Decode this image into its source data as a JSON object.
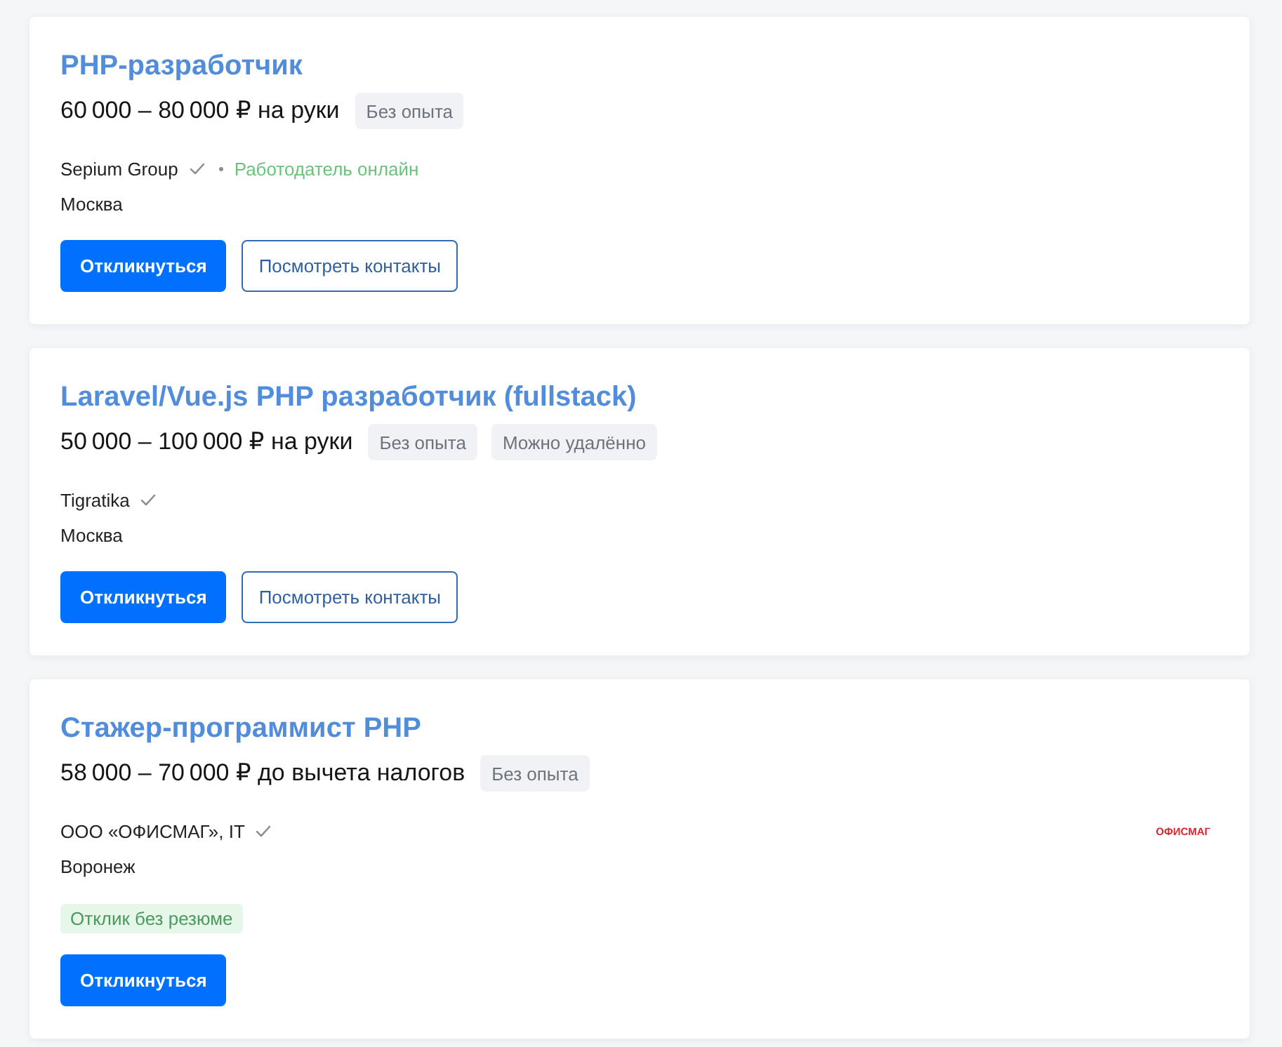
{
  "vacancies": [
    {
      "title": "PHP-разработчик",
      "salary": "60 000 – 80 000 ₽ на руки",
      "tags": [
        "Без опыта"
      ],
      "company": "Sepium Group",
      "verified": true,
      "online_status": "Работодатель онлайн",
      "city": "Москва",
      "buttons": [
        {
          "label": "Откликнуться",
          "kind": "primary"
        },
        {
          "label": "Посмотреть контакты",
          "kind": "outline"
        }
      ]
    },
    {
      "title": "Laravel/Vue.js PHP разработчик (fullstack)",
      "salary": "50 000 – 100 000 ₽ на руки",
      "tags": [
        "Без опыта",
        "Можно удалённо"
      ],
      "company": "Tigratika",
      "verified": true,
      "city": "Москва",
      "buttons": [
        {
          "label": "Откликнуться",
          "kind": "primary"
        },
        {
          "label": "Посмотреть контакты",
          "kind": "outline"
        }
      ]
    },
    {
      "title": "Стажер-программист PHP",
      "salary": "58 000 – 70 000 ₽ до вычета налогов",
      "tags": [
        "Без опыта"
      ],
      "company": "ООО «ОФИСМАГ», IT",
      "verified": true,
      "logo": "ОФИСМАГ",
      "city": "Воронеж",
      "badge": "Отклик без резюме",
      "buttons": [
        {
          "label": "Откликнуться",
          "kind": "primary"
        }
      ]
    }
  ]
}
